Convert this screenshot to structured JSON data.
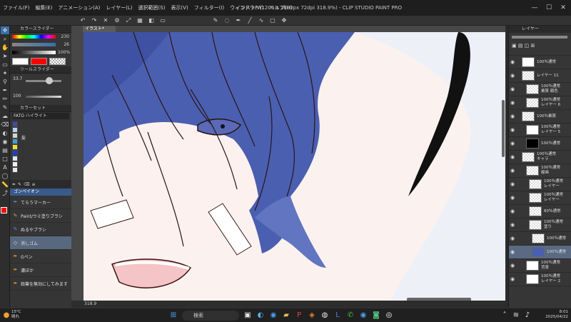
{
  "window": {
    "title": "イラスト* (1200 x 1600px 72dpi 318.9%) - CLIP STUDIO PAINT PRO",
    "minimize": "—",
    "maximize": "☐",
    "close": "✕"
  },
  "menu": [
    "ファイル(F)",
    "編集(E)",
    "アニメーション(A)",
    "レイヤー(L)",
    "選択範囲(S)",
    "表示(V)",
    "フィルター(I)",
    "ウィンドウ(W)",
    "ヘルプ(H)"
  ],
  "colors": {
    "accent": "#3b6ea8",
    "main_color": "#ff0000",
    "sub_color": "#ffffff",
    "hair_blue": "#4b5fb0"
  },
  "left_panel": {
    "color_slider_tab": "カラースライダー",
    "slider_values": [
      "230",
      "26",
      "100%"
    ],
    "tool_size_tab": "ツールスライダー",
    "tool_size_value": "33.7",
    "opacity_value": "100",
    "color_set_tab": "カラーセット",
    "color_set_name": "FATO ハイライト",
    "color_set_cell_label": "髪",
    "sub_tool_group": "ゴンペイオン",
    "sub_tools": [
      {
        "icon": "pen-icon",
        "label": "てらうマーカー"
      },
      {
        "icon": "brush-icon",
        "label": "Paint/ウミ塗りブラシ"
      },
      {
        "icon": "brush-icon",
        "label": "ぬるやブラシ"
      },
      {
        "icon": "eraser-icon",
        "label": "消しゴム",
        "active": true
      },
      {
        "icon": "pen-icon",
        "label": "Gペン"
      },
      {
        "icon": "pen-icon",
        "label": "濃ぼか"
      },
      {
        "icon": "pen-icon",
        "label": "鉛筆を無効にしてみます"
      }
    ]
  },
  "canvas": {
    "tab_label": "イラスト*",
    "zoom": "318.9"
  },
  "layers": {
    "tab": "レイヤー",
    "items": [
      {
        "label": "100％通常",
        "label2": "",
        "thumb": "white"
      },
      {
        "label": "レイヤー 11",
        "label2": "",
        "thumb": "checker"
      },
      {
        "label": "100％通常",
        "label2": "乗算 顔色",
        "thumb": "checker"
      },
      {
        "label": "100％通常",
        "label2": "レイヤー 6",
        "thumb": "checker"
      },
      {
        "label": "100％乗算",
        "label2": "",
        "thumb": "checker"
      },
      {
        "label": "100％通常",
        "label2": "レイヤー 5",
        "thumb": "white"
      },
      {
        "label": "100％通常",
        "label2": "",
        "thumb": "black"
      },
      {
        "label": "100％通常",
        "label2": "キャラ",
        "thumb": "checker"
      },
      {
        "label": "100％通常",
        "label2": "線画",
        "thumb": "checker"
      },
      {
        "label": "100％通常",
        "label2": "レイヤー",
        "thumb": "checker"
      },
      {
        "label": "100％通常",
        "label2": "レイヤー",
        "thumb": "checker"
      },
      {
        "label": "80％通常",
        "label2": "",
        "thumb": "checker"
      },
      {
        "label": "100％通常",
        "label2": "塗り",
        "thumb": "checker"
      },
      {
        "label": "100％通常",
        "label2": "",
        "thumb": "checker"
      },
      {
        "label": "100％通常",
        "label2": "",
        "thumb": "blue",
        "active": true
      },
      {
        "label": "100％通常",
        "label2": "背景",
        "thumb": "white"
      },
      {
        "label": "100％通常",
        "label2": "レイヤー 2",
        "thumb": "white"
      }
    ]
  },
  "taskbar": {
    "weather_temp": "15°C",
    "weather_text": "晴れ",
    "search_label": "検索",
    "time": "8:01",
    "date": "2025/04/22"
  }
}
